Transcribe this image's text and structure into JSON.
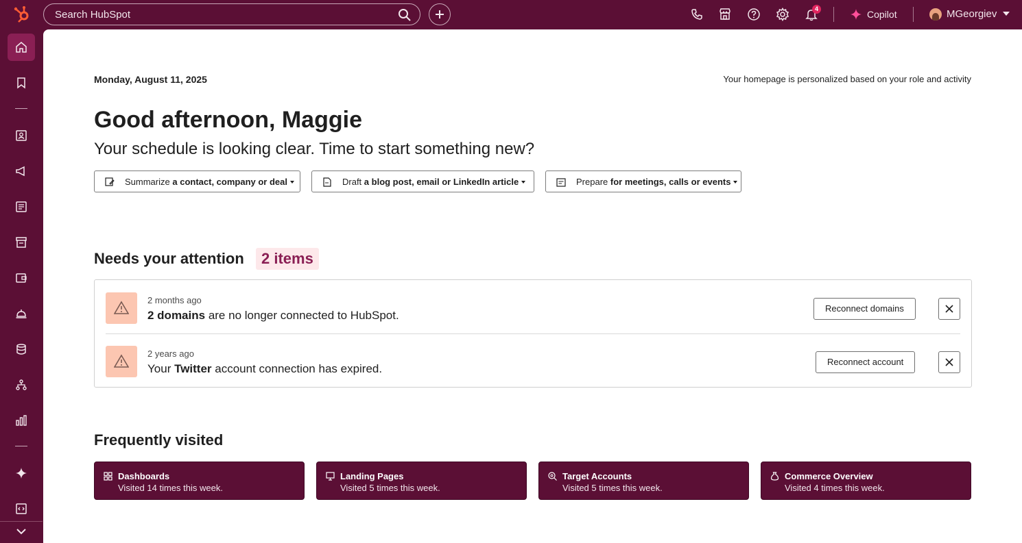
{
  "colors": {
    "brand": "#5b0f35",
    "accent": "#ff5c35",
    "badge": "#e0245e",
    "warning_bg": "#fcc6b1",
    "pill_bg": "#fde8ea"
  },
  "topbar": {
    "search_placeholder": "Search HubSpot",
    "notification_count": "4",
    "copilot_label": "Copilot",
    "user_name": "MGeorgiev",
    "icons": [
      "phone-icon",
      "marketplace-icon",
      "help-icon",
      "settings-icon",
      "bell-icon"
    ]
  },
  "leftnav": {
    "items": [
      "home",
      "bookmarks",
      "contacts",
      "marketing",
      "content",
      "commerce",
      "sales",
      "service",
      "data-management",
      "automation",
      "reporting",
      "breeze",
      "development"
    ]
  },
  "main": {
    "date": "Monday, August 11, 2025",
    "personalized_note": "Your homepage is personalized based on your role and activity",
    "greeting": "Good afternoon, Maggie",
    "subgreeting": "Your schedule is looking clear. Time to start something new?",
    "actions": [
      {
        "verb": "Summarize",
        "object": "a contact, company or deal"
      },
      {
        "verb": "Draft",
        "object": "a blog post, email or LinkedIn article"
      },
      {
        "verb": "Prepare",
        "object": "for meetings, calls or events"
      }
    ],
    "attention": {
      "title": "Needs your attention",
      "count": "2 items",
      "items": [
        {
          "time": "2 months ago",
          "bold": "2 domains",
          "rest": " are no longer connected to HubSpot.",
          "prefix": "",
          "button": "Reconnect domains"
        },
        {
          "time": "2 years ago",
          "prefix": "Your ",
          "bold": "Twitter",
          "rest": " account connection has expired.",
          "button": "Reconnect account"
        }
      ]
    },
    "frequent": {
      "title": "Frequently visited",
      "cards": [
        {
          "title": "Dashboards",
          "sub": "Visited 14 times this week."
        },
        {
          "title": "Landing Pages",
          "sub": "Visited 5 times this week."
        },
        {
          "title": "Target Accounts",
          "sub": "Visited 5 times this week."
        },
        {
          "title": "Commerce Overview",
          "sub": "Visited 4 times this week."
        }
      ]
    }
  }
}
